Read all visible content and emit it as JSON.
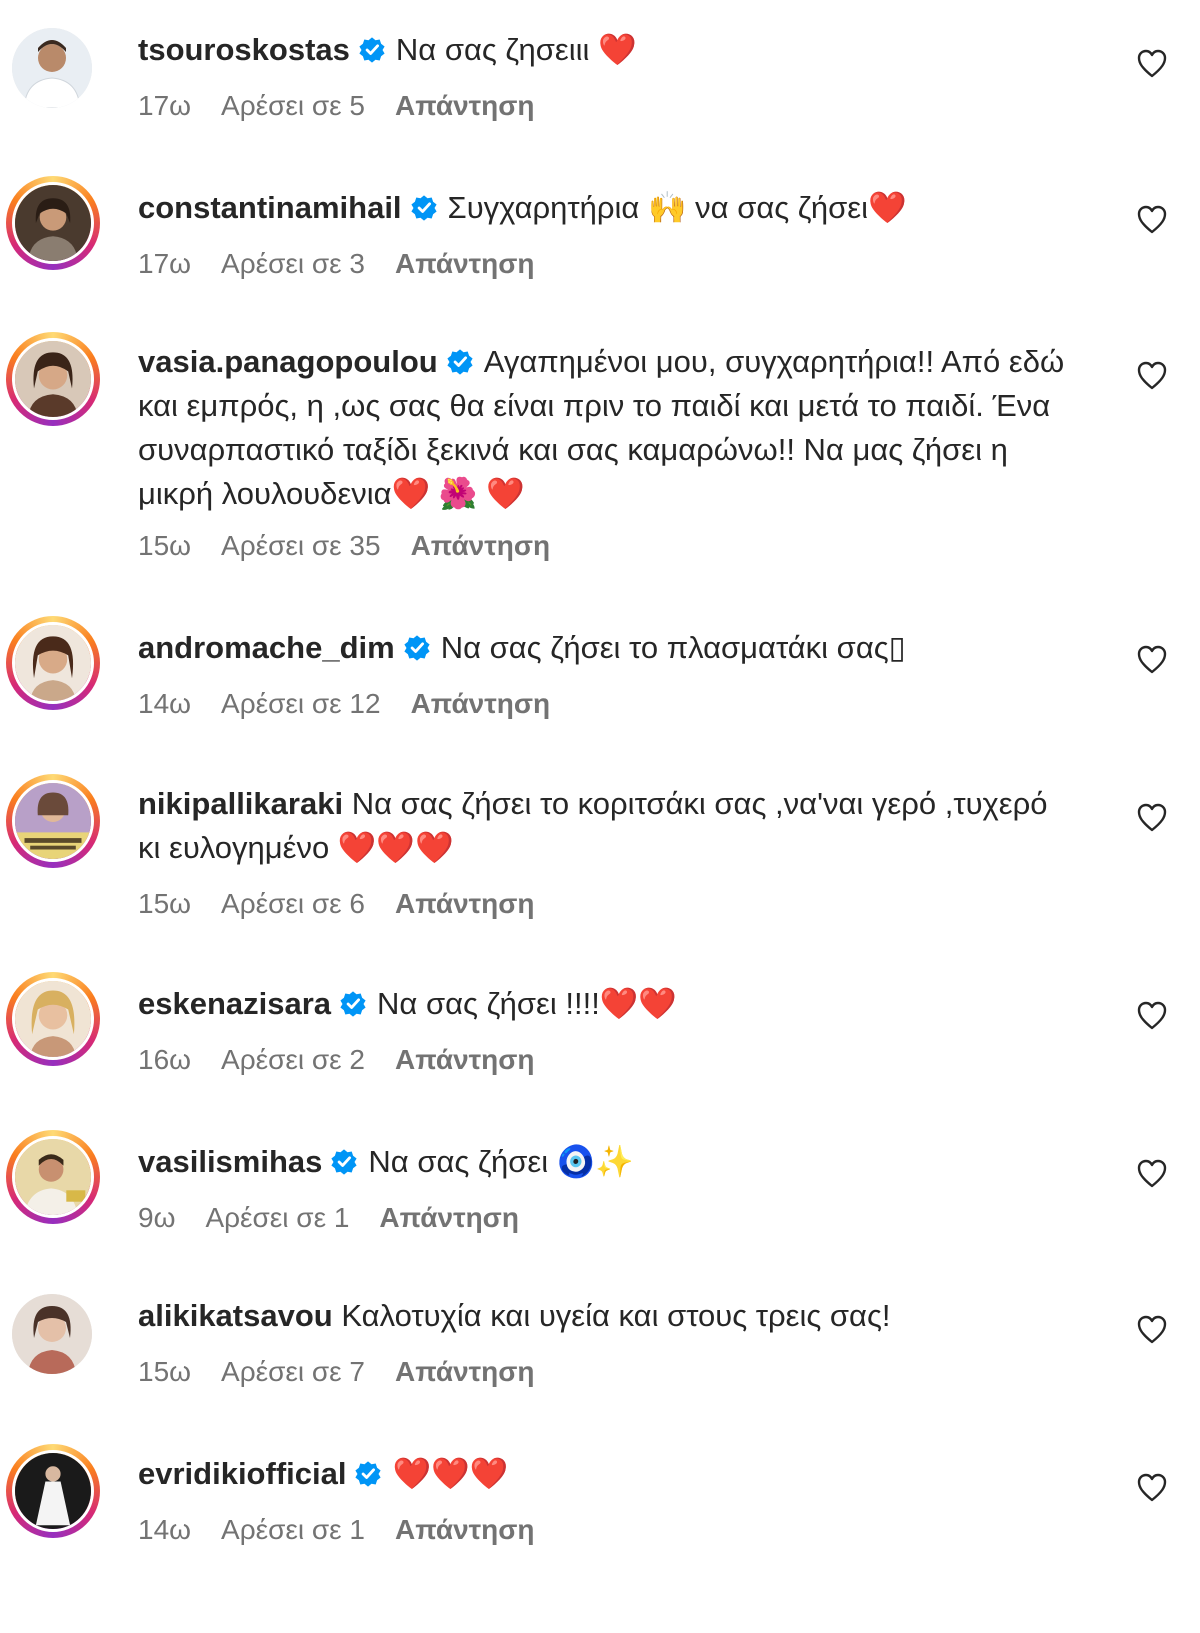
{
  "colors": {
    "text": "#262626",
    "meta": "#737373",
    "verified": "#0095f6",
    "heart": "#e0163f"
  },
  "comments": [
    {
      "username": "tsouroskostas",
      "verified": true,
      "text": "Να σας ζησειιι ❤️",
      "time": "17ω",
      "likes": "Αρέσει σε 5",
      "reply": "Απάντηση",
      "avatar_icon": "man-portrait",
      "story_ring": false
    },
    {
      "username": "constantinamihail",
      "verified": true,
      "text": "Συγχαρητήρια 🙌 να σας ζήσει❤️",
      "time": "17ω",
      "likes": "Αρέσει σε 3",
      "reply": "Απάντηση",
      "avatar_icon": "woman-portrait",
      "story_ring": true
    },
    {
      "username": "vasia.panagopoulou",
      "verified": true,
      "text": "Αγαπημένοι μου, συγχαρητήρια!! Από εδώ και εμπρός, η ,ως σας θα είναι πριν το παιδί και μετά το παιδί. Ένα συναρπαστικό ταξίδι ξεκινά και σας καμαρώνω!! Να μας ζήσει η μικρή λουλουδενια❤️ 🌺 ❤️",
      "time": "15ω",
      "likes": "Αρέσει σε 35",
      "reply": "Απάντηση",
      "avatar_icon": "woman-portrait",
      "story_ring": true
    },
    {
      "username": "andromache_dim",
      "verified": true,
      "text": "Να σας ζήσει το πλασματάκι σας▯",
      "time": "14ω",
      "likes": "Αρέσει σε 12",
      "reply": "Απάντηση",
      "avatar_icon": "woman-portrait",
      "story_ring": true
    },
    {
      "username": "nikipallikaraki",
      "verified": false,
      "text": "Να σας ζήσει το κοριτσάκι σας ,να'ναι γερό ,τυχερό κι ευλογημένο ❤️❤️❤️",
      "time": "15ω",
      "likes": "Αρέσει σε 6",
      "reply": "Απάντηση",
      "avatar_icon": "poster-portrait",
      "story_ring": true
    },
    {
      "username": "eskenazisara",
      "verified": true,
      "text": "Να σας ζήσει !!!!❤️❤️",
      "time": "16ω",
      "likes": "Αρέσει σε 2",
      "reply": "Απάντηση",
      "avatar_icon": "woman-portrait",
      "story_ring": true
    },
    {
      "username": "vasilismihas",
      "verified": true,
      "text": "Να σας ζήσει 🧿✨",
      "time": "9ω",
      "likes": "Αρέσει σε 1",
      "reply": "Απάντηση",
      "avatar_icon": "man-portrait",
      "story_ring": true
    },
    {
      "username": "alikikatsavou",
      "verified": false,
      "text": "Καλοτυχία και υγεία και στους τρεις σας!",
      "time": "15ω",
      "likes": "Αρέσει σε 7",
      "reply": "Απάντηση",
      "avatar_icon": "woman-portrait",
      "story_ring": false
    },
    {
      "username": "evridikiofficial",
      "verified": true,
      "text": "❤️❤️❤️",
      "time": "14ω",
      "likes": "Αρέσει σε 1",
      "reply": "Απάντηση",
      "avatar_icon": "dress-portrait",
      "story_ring": true
    }
  ]
}
